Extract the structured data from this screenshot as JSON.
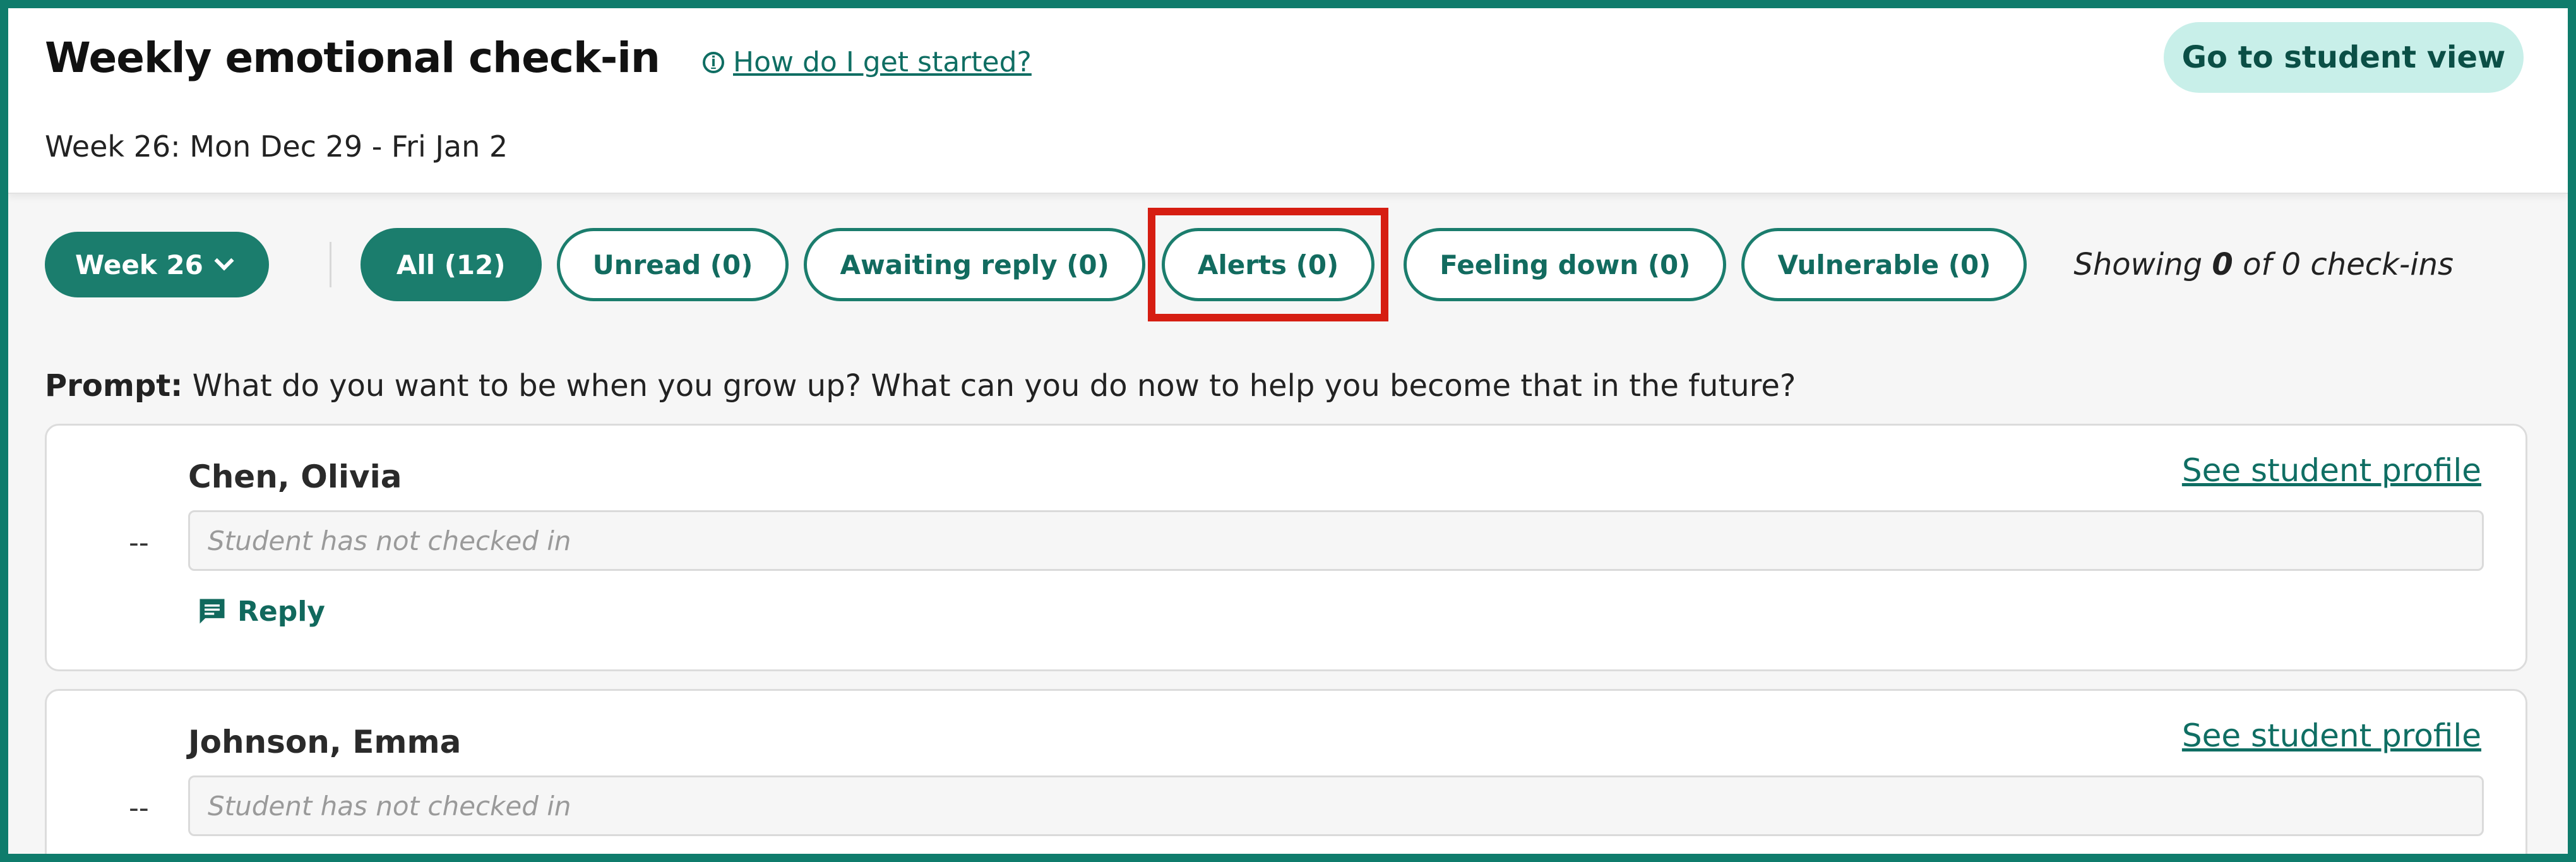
{
  "header": {
    "title": "Weekly emotional check-in",
    "help_link": "How do I get started?",
    "student_view_button": "Go to student view",
    "week_range": "Week 26: Mon Dec 29 - Fri Jan 2"
  },
  "filters": {
    "week_select": "Week 26",
    "pills": [
      {
        "label": "All (12)",
        "active": true
      },
      {
        "label": "Unread (0)",
        "active": false
      },
      {
        "label": "Awaiting reply (0)",
        "active": false
      },
      {
        "label": "Alerts (0)",
        "active": false,
        "highlighted": true
      },
      {
        "label": "Feeling down (0)",
        "active": false
      },
      {
        "label": "Vulnerable (0)",
        "active": false
      }
    ],
    "showing_prefix": "Showing",
    "showing_count": "0",
    "showing_suffix": "of 0 check-ins"
  },
  "prompt": {
    "label": "Prompt:",
    "text": "What do you want to be when you grow up? What can you do now to help you become that in the future?"
  },
  "checkins": [
    {
      "mood": "--",
      "name": "Chen, Olivia",
      "profile_link": "See student profile",
      "response_placeholder": "Student has not checked in",
      "reply_label": "Reply"
    },
    {
      "mood": "--",
      "name": "Johnson, Emma",
      "profile_link": "See student profile",
      "response_placeholder": "Student has not checked in"
    }
  ],
  "colors": {
    "brand": "#1b7d6d",
    "highlight": "#d61e12",
    "student_view_bg": "#c8efe9"
  }
}
